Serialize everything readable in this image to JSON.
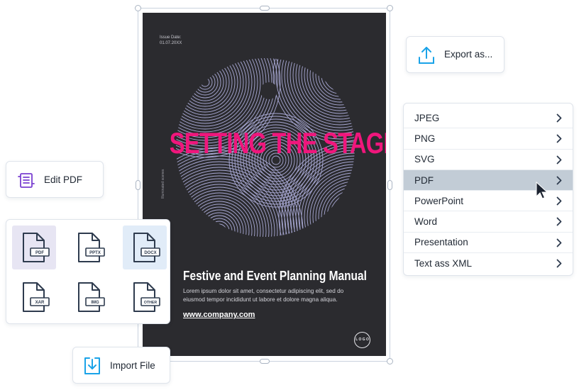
{
  "poster": {
    "issue_label": "Issue Date:",
    "issue_date": "01.07.20XX",
    "side_text": "Illuminated scenes",
    "title": "SETTING THE STAGE",
    "heading": "Festive and Event Planning Manual",
    "body": "Lorem ipsum dolor sit amet, consectetur adipiscing elit, sed do eiusmod tempor incididunt ut labore et dolore magna aliqua.",
    "url": "www.company.com",
    "logo_text": "L O G O",
    "colors": {
      "background": "#2b2b2f",
      "title": "#f0167c",
      "art": "#b8b8e8"
    }
  },
  "export_button": {
    "label": "Export as...",
    "icon": "upload-icon"
  },
  "edit_button": {
    "label": "Edit PDF",
    "icon": "document-edit-icon"
  },
  "import_button": {
    "label": "Import File",
    "icon": "download-icon"
  },
  "export_menu": {
    "items": [
      {
        "label": "JPEG"
      },
      {
        "label": "PNG"
      },
      {
        "label": "SVG"
      },
      {
        "label": "PDF",
        "selected": true
      },
      {
        "label": "PowerPoint"
      },
      {
        "label": "Word"
      },
      {
        "label": "Presentation"
      },
      {
        "label": "Text ass XML"
      }
    ]
  },
  "file_types": [
    {
      "label": "PDF",
      "state": "selected-purple"
    },
    {
      "label": "PPTX",
      "state": "normal"
    },
    {
      "label": "DOCX",
      "state": "selected-blue"
    },
    {
      "label": "XAR",
      "state": "normal"
    },
    {
      "label": "IMG",
      "state": "normal"
    },
    {
      "label": "OTHER",
      "state": "normal"
    }
  ],
  "colors": {
    "accent_blue": "#1aa3e8",
    "accent_purple": "#7a3fd1",
    "icon_stroke": "#2e3b4e",
    "menu_selected": "#c2ccd6"
  }
}
